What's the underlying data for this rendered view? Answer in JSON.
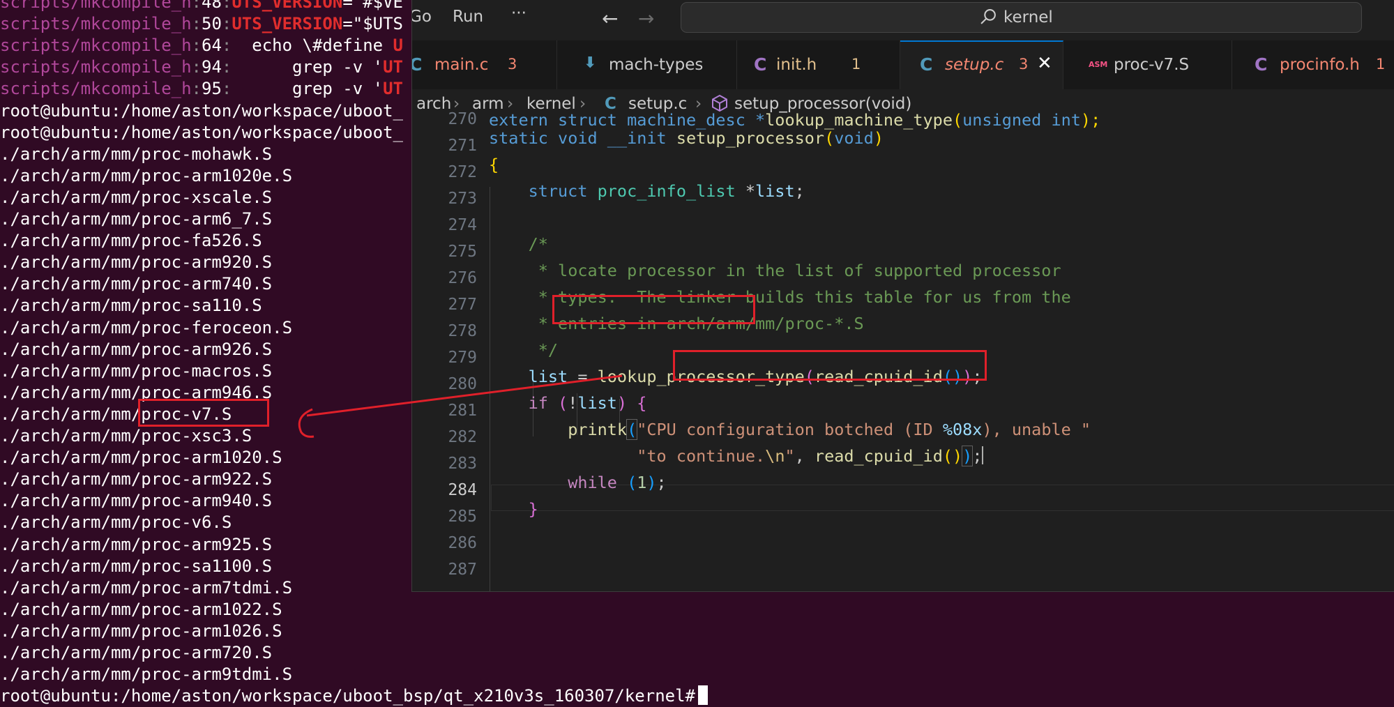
{
  "terminal": {
    "grep_lines": [
      {
        "file": "scripts/mkcompile_h",
        "line": "48",
        "pre": "",
        "match": "UTS_VERSION",
        "post": "=\"#$VE"
      },
      {
        "file": "scripts/mkcompile_h",
        "line": "50",
        "pre": "",
        "match": "UTS_VERSION",
        "post": "=\"$UTS"
      },
      {
        "file": "scripts/mkcompile_h",
        "line": "64",
        "pre": "  echo \\#define ",
        "match": "U",
        "post": ""
      },
      {
        "file": "scripts/mkcompile_h",
        "line": "94",
        "pre": "      grep -v '",
        "match": "UT",
        "post": ""
      },
      {
        "file": "scripts/mkcompile_h",
        "line": "95",
        "pre": "      grep -v '",
        "match": "UT",
        "post": ""
      }
    ],
    "prompt_lines": [
      "root@ubuntu:/home/aston/workspace/uboot_",
      "root@ubuntu:/home/aston/workspace/uboot_"
    ],
    "files": [
      "./arch/arm/mm/proc-mohawk.S",
      "./arch/arm/mm/proc-arm1020e.S",
      "./arch/arm/mm/proc-xscale.S",
      "./arch/arm/mm/proc-arm6_7.S",
      "./arch/arm/mm/proc-fa526.S",
      "./arch/arm/mm/proc-arm920.S",
      "./arch/arm/mm/proc-arm740.S",
      "./arch/arm/mm/proc-sa110.S",
      "./arch/arm/mm/proc-feroceon.S",
      "./arch/arm/mm/proc-arm926.S",
      "./arch/arm/mm/proc-macros.S",
      "./arch/arm/mm/proc-arm946.S",
      "./arch/arm/mm/proc-v7.S",
      "./arch/arm/mm/proc-xsc3.S",
      "./arch/arm/mm/proc-arm1020.S",
      "./arch/arm/mm/proc-arm922.S",
      "./arch/arm/mm/proc-arm940.S",
      "./arch/arm/mm/proc-v6.S",
      "./arch/arm/mm/proc-arm925.S",
      "./arch/arm/mm/proc-sa1100.S",
      "./arch/arm/mm/proc-arm7tdmi.S",
      "./arch/arm/mm/proc-arm1022.S",
      "./arch/arm/mm/proc-arm1026.S",
      "./arch/arm/mm/proc-arm720.S",
      "./arch/arm/mm/proc-arm9tdmi.S"
    ],
    "final_prompt": "root@ubuntu:/home/aston/workspace/uboot_bsp/qt_x210v3s_160307/kernel#"
  },
  "vscode": {
    "menu": {
      "go": "Go",
      "run": "Run",
      "more": "···"
    },
    "search": "kernel",
    "tabs": [
      {
        "icon": "C",
        "icon_color": "#519aba",
        "label": "main.c",
        "label_color": "#f48771",
        "count": "3"
      },
      {
        "icon": "⬇",
        "icon_color": "#519aba",
        "label": "mach-types",
        "label_color": "#cccccc",
        "count": ""
      },
      {
        "icon": "C",
        "icon_color": "#a074c4",
        "label": "init.h",
        "label_color": "#e2c08d",
        "count": "1"
      },
      {
        "icon": "C",
        "icon_color": "#519aba",
        "label": "setup.c",
        "label_color": "#f48771",
        "count": "3",
        "active": true
      },
      {
        "icon": "ASM",
        "icon_color": "#f55385",
        "label": "proc-v7.S",
        "label_color": "#cccccc",
        "count": ""
      },
      {
        "icon": "C",
        "icon_color": "#a074c4",
        "label": "procinfo.h",
        "label_color": "#f48771",
        "count": "1"
      }
    ],
    "close_glyph": "✕",
    "breadcrumb": {
      "p1": "arch",
      "p2": "arm",
      "p3": "kernel",
      "file_icon": "C",
      "file": "setup.c",
      "symbol": "setup_processor(void)"
    },
    "line_numbers": [
      "270",
      "271",
      "272",
      "273",
      "274",
      "275",
      "276",
      "277",
      "278",
      "279",
      "280",
      "281",
      "282",
      "283",
      "284",
      "285",
      "286",
      "287"
    ],
    "current_line": "284",
    "code": {
      "l270": {
        "a": "extern struct machine_desc *",
        "b": "lookup_machine_type",
        "c": "(",
        "d": "unsigned int",
        "e": ");"
      },
      "l272": {
        "kw1": "static",
        "kw2": "void",
        "mac": "__init",
        "fn": "setup_processor",
        "po": "(",
        "arg": "void",
        "pc": ")"
      },
      "l273": {
        "brace": "{"
      },
      "l274": {
        "kw": "struct",
        "ty": "proc_info_list",
        "rest": " *",
        "var": "list",
        "end": ";"
      },
      "l276": "/*",
      "l277": {
        "a": " * ",
        "b": "locate processor",
        "c": " in the list of supported processor"
      },
      "l278": " * types.  The linker builds this table for us from the",
      "l279": {
        "a": " * entries in ",
        "b": "arch/arm/mm/proc-*.S"
      },
      "l280": " */",
      "l281": {
        "var": "list",
        "eq": " = ",
        "fn": "lookup_processor_type",
        "p1": "(",
        "fn2": "read_cpuid_id",
        "p2": "()",
        "p1c": ")",
        "end": ";"
      },
      "l282": {
        "kw": "if",
        "po": " (",
        "op": "!",
        "var": "list",
        "pc": ")",
        "brace": " {"
      },
      "l283": {
        "fn": "printk",
        "po": "(",
        "s1": "\"CPU configuration botched (ID ",
        "fmt": "%08x",
        "s2": "), unable \""
      },
      "l284": {
        "s1": "\"to continue.",
        "esc": "\\n",
        "s2": "\"",
        "comma": ", ",
        "fn": "read_cpuid_id",
        "p2": "()",
        "pc": ")",
        "end": ";"
      },
      "l285": {
        "kw": "while",
        "po": " (",
        "num": "1",
        "pc": ")",
        "end": ";"
      },
      "l286": {
        "brace": "}"
      }
    }
  },
  "annotations": {
    "color": "#e0202a"
  }
}
